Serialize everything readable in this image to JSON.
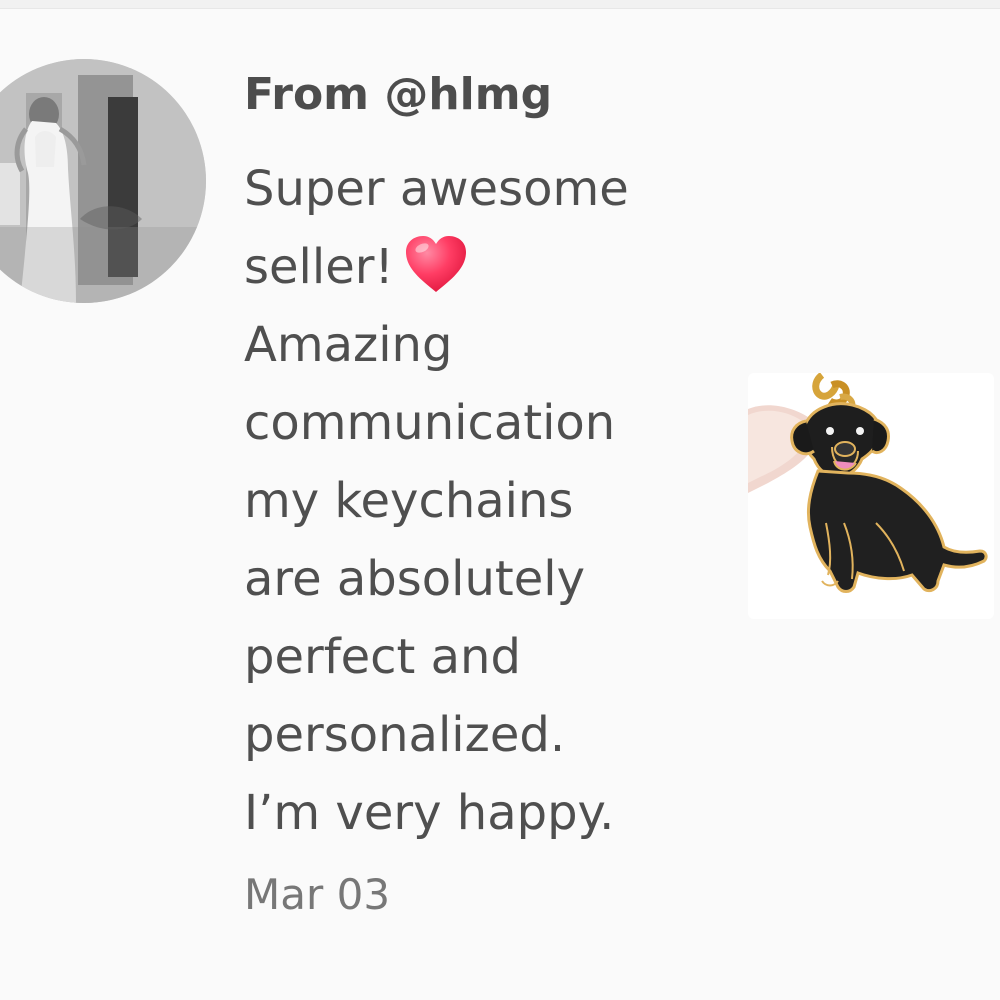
{
  "review": {
    "author": "From @hlmg",
    "text_lines": [
      "Super awesome",
      "seller!",
      "Amazing",
      "communication",
      "my keychains",
      "are absolutely",
      "perfect and",
      "personalized.",
      "I’m very happy."
    ],
    "reaction_icon": "heart-icon",
    "date": "Mar 03"
  },
  "product": {
    "icon": "black-dog-keychain-photo"
  },
  "colors": {
    "background": "#fafafa",
    "text": "#4f4f4f",
    "heart": "#ff355e"
  }
}
